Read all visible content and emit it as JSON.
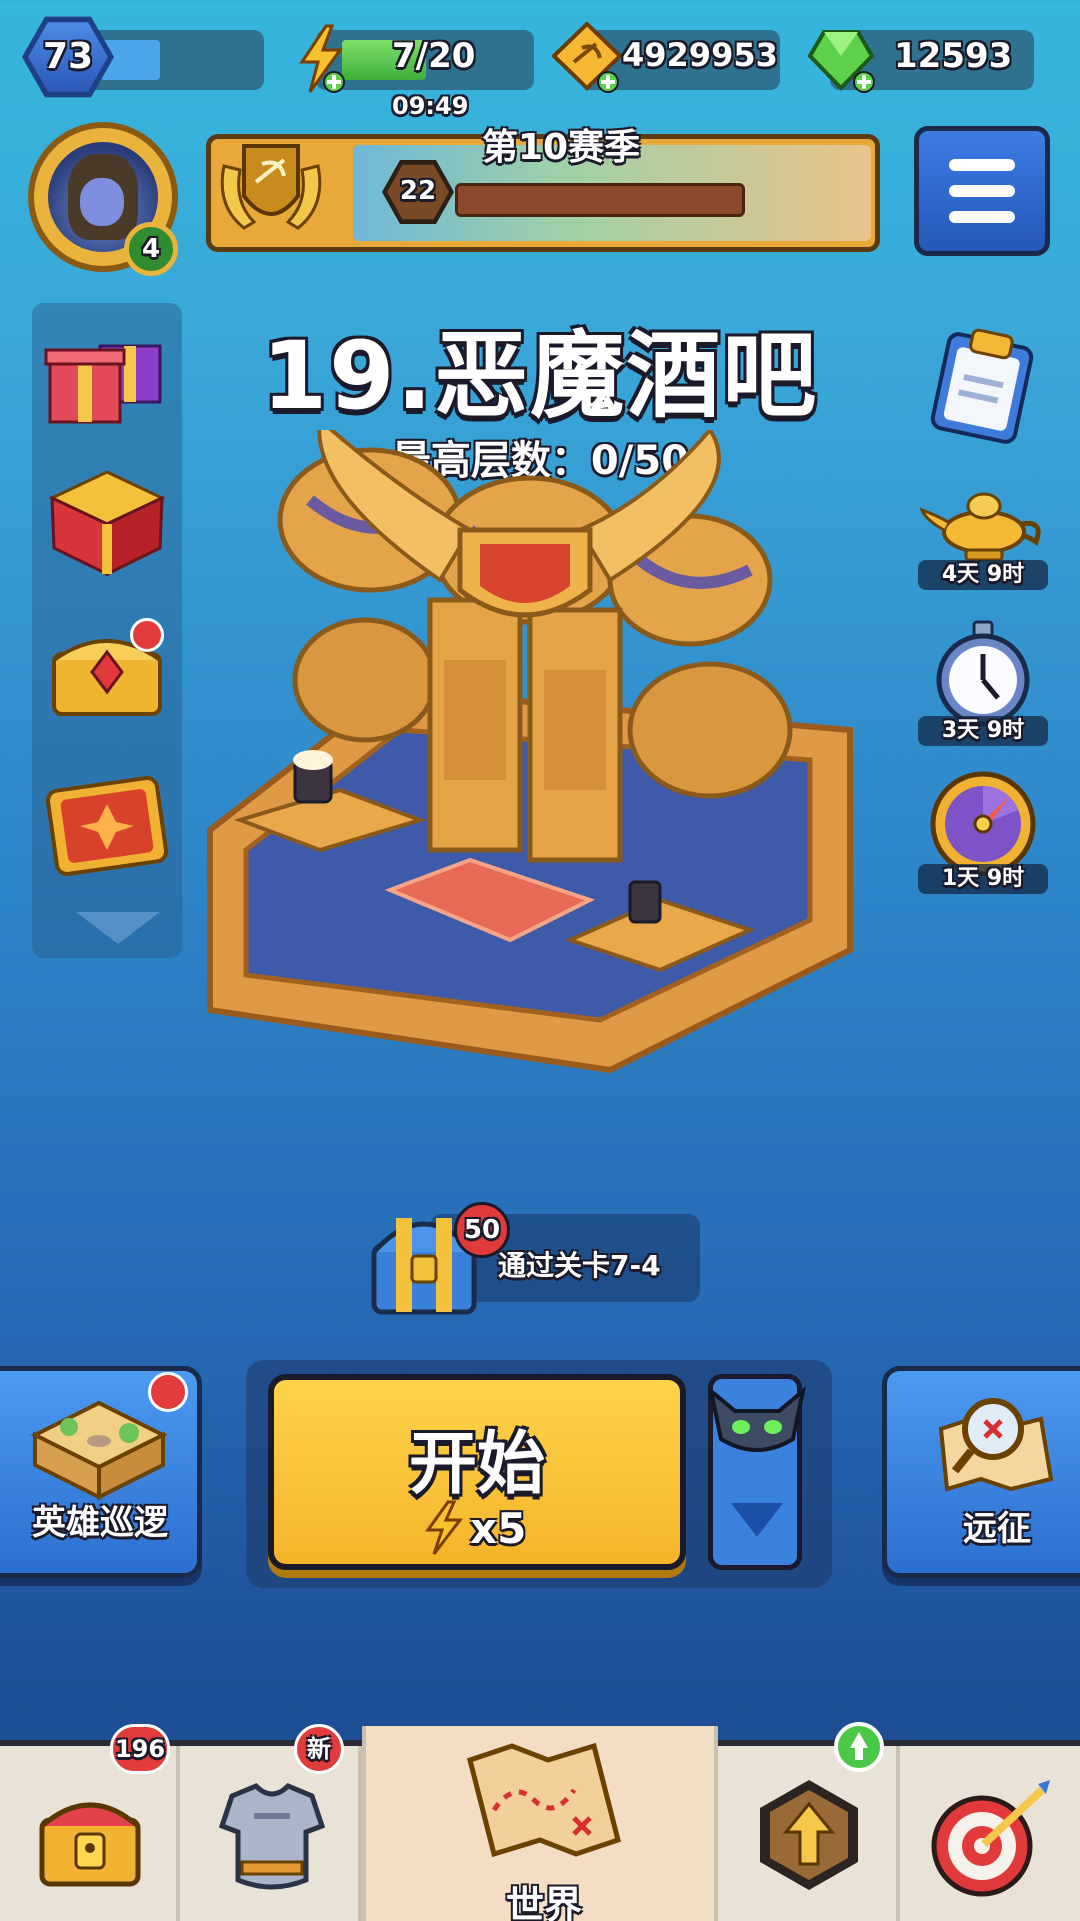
{
  "player": {
    "level": "73",
    "hero_level": "4"
  },
  "resources": {
    "energy": "7/20",
    "energy_timer": "09:49",
    "gold": "4929953",
    "gems": "12593"
  },
  "season": {
    "title": "第10赛季",
    "rank": "22"
  },
  "stage": {
    "title": "19.恶魔酒吧",
    "best_floor": "最高层数：0/50"
  },
  "timers": [
    {
      "name": "lamp",
      "label": "4天 9时"
    },
    {
      "name": "stopwatch",
      "label": "3天 9时"
    },
    {
      "name": "wheel",
      "label": "1天 9时"
    }
  ],
  "reward_chest": {
    "count": "50",
    "hint": "通过关卡7-4"
  },
  "actions": {
    "patrol_label": "英雄巡逻",
    "start_label": "开始",
    "start_cost": "x5",
    "expedition_label": "远征"
  },
  "nav": {
    "chest_badge": "196",
    "gear_badge": "新",
    "world_label": "世界"
  },
  "colors": {
    "accent_yellow": "#f7c431",
    "sky_blue": "#35b6dc",
    "deep_blue": "#1e4f96",
    "badge_red": "#e23b3b"
  }
}
